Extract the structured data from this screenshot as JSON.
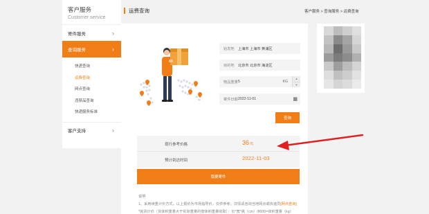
{
  "sidebar": {
    "title": "客户服务",
    "subtitle": "Customer service",
    "items": [
      {
        "label": "寄件服务",
        "chevron": "›"
      },
      {
        "label": "查询服务",
        "chevron": "›"
      },
      {
        "label": "客户支持",
        "chevron": "›"
      }
    ],
    "sub_items": [
      {
        "label": "快递查询"
      },
      {
        "label": "运费查询"
      },
      {
        "label": "网点查询"
      },
      {
        "label": "违禁品查询"
      },
      {
        "label": "快递服务标准"
      }
    ]
  },
  "header": {
    "title": "运费查询",
    "breadcrumb": "客户服务 > 查询服务 > 运费查询"
  },
  "form": {
    "origin": {
      "label": "始发地",
      "value": "上海市 上海市 黄浦区"
    },
    "destination": {
      "label": "目的地",
      "value": "北京市 北京市 海淀区"
    },
    "weight": {
      "label": "物品重量",
      "value": "5",
      "unit": "KG"
    },
    "date": {
      "label": "寄件日期",
      "value": "2022-11-01"
    },
    "query_button": "查询"
  },
  "result": {
    "price_label": "现行参考价格",
    "price_value": "36",
    "price_unit": "元",
    "arrival_label": "预计到达时间",
    "arrival_value": "2022-11-03",
    "send_button": "我要寄件"
  },
  "notes": {
    "title": "说明",
    "line1_prefix": "1、采用续重计价方式，以上报价为市场指导价，仅供参考；详情请咨询当地网点或快递员",
    "line1_link": "[网点查询]",
    "line2": "*抛货计价（货体积重量大于实际重量的按体积重量收取）：长*宽*高（cm）/8000=体积重量（kg）"
  },
  "colors": {
    "accent": "#f07d16",
    "arrow": "#e02020"
  }
}
